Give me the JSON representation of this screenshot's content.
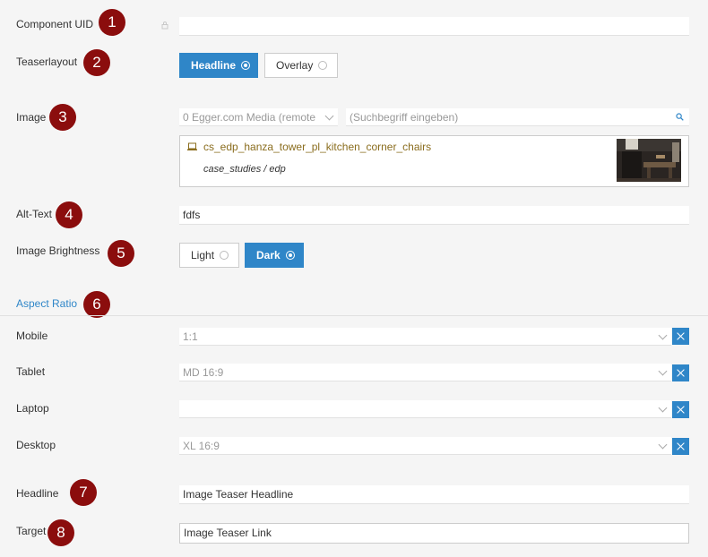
{
  "markers": [
    "1",
    "2",
    "3",
    "4",
    "5",
    "6",
    "7",
    "8"
  ],
  "component_uid": {
    "label": "Component UID",
    "value": ""
  },
  "teaserlayout": {
    "label": "Teaserlayout",
    "options": [
      "Headline",
      "Overlay"
    ],
    "selected": "Headline"
  },
  "image": {
    "label": "Image",
    "source_select": "0 Egger.com Media (remote",
    "search_placeholder": "(Suchbegriff eingeben)",
    "file_name": "cs_edp_hanza_tower_pl_kitchen_corner_chairs",
    "file_path": "case_studies / edp"
  },
  "alt_text": {
    "label": "Alt-Text",
    "value": "fdfs"
  },
  "image_brightness": {
    "label": "Image Brightness",
    "options": [
      "Light",
      "Dark"
    ],
    "selected": "Dark"
  },
  "aspect_ratio": {
    "title": "Aspect Ratio",
    "rows": [
      {
        "label": "Mobile",
        "value": "1:1"
      },
      {
        "label": "Tablet",
        "value": "MD 16:9"
      },
      {
        "label": "Laptop",
        "value": ""
      },
      {
        "label": "Desktop",
        "value": "XL 16:9"
      }
    ]
  },
  "headline": {
    "label": "Headline",
    "value": "Image Teaser Headline"
  },
  "target": {
    "label": "Target",
    "value": "Image Teaser Link"
  },
  "colors": {
    "accent": "#2f86c8",
    "marker": "#8b0d0d",
    "file_link": "#8a6d1e"
  }
}
